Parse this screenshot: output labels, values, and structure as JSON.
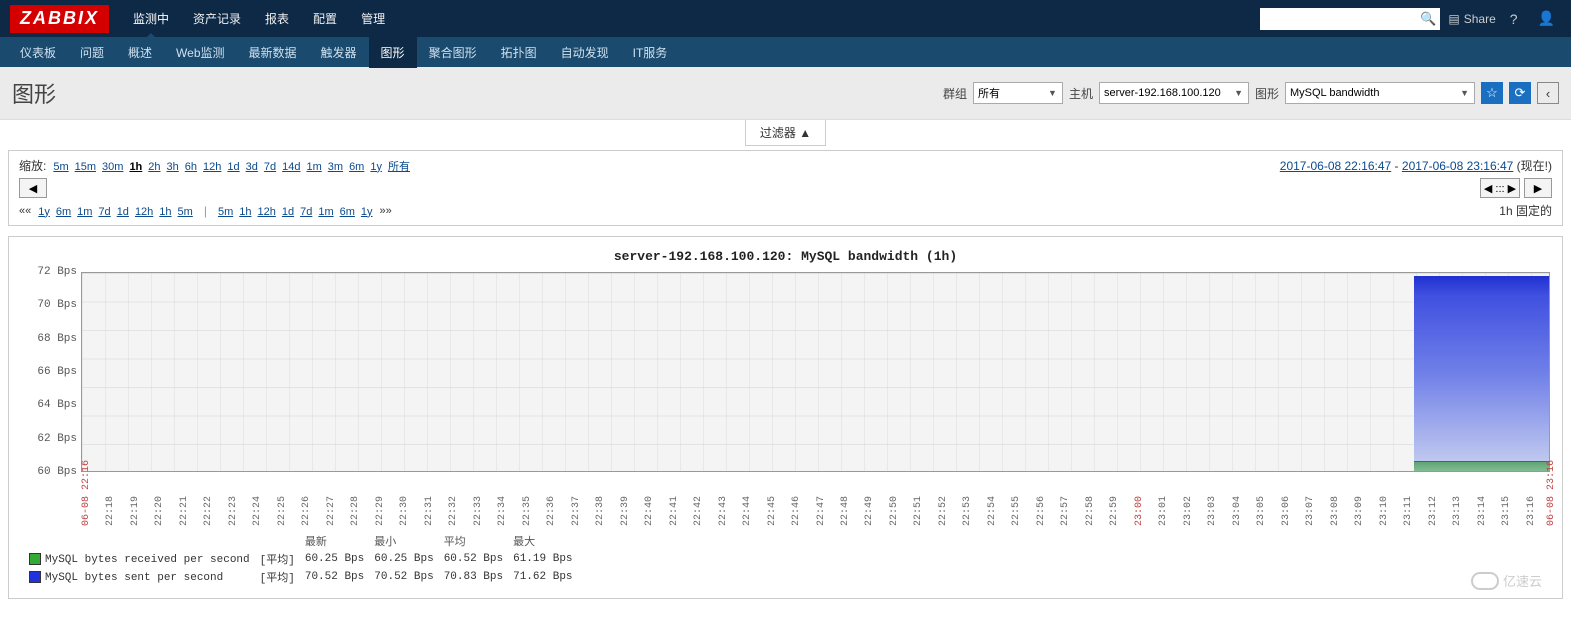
{
  "app": {
    "logo": "ZABBIX"
  },
  "topnav": [
    "监测中",
    "资产记录",
    "报表",
    "配置",
    "管理"
  ],
  "topnav_active": 0,
  "subnav": [
    "仪表板",
    "问题",
    "概述",
    "Web监测",
    "最新数据",
    "触发器",
    "图形",
    "聚合图形",
    "拓扑图",
    "自动发现",
    "IT服务"
  ],
  "subnav_active": 6,
  "top_right": {
    "share": "Share",
    "help": "?",
    "search_placeholder": ""
  },
  "page_title": "图形",
  "filters": {
    "group_label": "群组",
    "group_value": "所有",
    "host_label": "主机",
    "host_value": "server-192.168.100.120",
    "graph_label": "图形",
    "graph_value": "MySQL bandwidth"
  },
  "filter_toggle": "过滤器 ▲",
  "zoom": {
    "label": "缩放:",
    "options": [
      "5m",
      "15m",
      "30m",
      "1h",
      "2h",
      "3h",
      "6h",
      "12h",
      "1d",
      "3d",
      "7d",
      "14d",
      "1m",
      "3m",
      "6m",
      "1y",
      "所有"
    ],
    "selected": "1h",
    "range_from": "2017-06-08 22:16:47",
    "range_sep": " - ",
    "range_to": "2017-06-08 23:16:47",
    "now_text": " (现在!)"
  },
  "shift_left_pre": "««",
  "shift_left": [
    "1y",
    "6m",
    "1m",
    "7d",
    "1d",
    "12h",
    "1h",
    "5m"
  ],
  "shift_right": [
    "5m",
    "1h",
    "12h",
    "1d",
    "7d",
    "1m",
    "6m",
    "1y"
  ],
  "shift_right_post": "»»",
  "fixed_label": "固定的",
  "fixed_duration": "1h",
  "nav_buttons": {
    "prev": "◀",
    "mid": "◀ ::: ▶",
    "next": "▶"
  },
  "chart_data": {
    "type": "area",
    "title": "server-192.168.100.120: MySQL bandwidth (1h)",
    "ylabel": "Bps",
    "yticks": [
      72,
      70,
      68,
      66,
      64,
      62,
      60
    ],
    "ylim": [
      60,
      72
    ],
    "x_start": "06-08 22:16",
    "x_end": "06-08 23:16",
    "x_minutes": [
      "22:18",
      "22:19",
      "22:20",
      "22:21",
      "22:22",
      "22:23",
      "22:24",
      "22:25",
      "22:26",
      "22:27",
      "22:28",
      "22:29",
      "22:30",
      "22:31",
      "22:32",
      "22:33",
      "22:34",
      "22:35",
      "22:36",
      "22:37",
      "22:38",
      "22:39",
      "22:40",
      "22:41",
      "22:42",
      "22:43",
      "22:44",
      "22:45",
      "22:46",
      "22:47",
      "22:48",
      "22:49",
      "22:50",
      "22:51",
      "22:52",
      "22:53",
      "22:54",
      "22:55",
      "22:56",
      "22:57",
      "22:58",
      "22:59",
      "23:00",
      "23:01",
      "23:02",
      "23:03",
      "23:04",
      "23:05",
      "23:06",
      "23:07",
      "23:08",
      "23:09",
      "23:10",
      "23:11",
      "23:12",
      "23:13",
      "23:14",
      "23:15",
      "23:16"
    ],
    "x_hour_marks": [
      "23:00"
    ],
    "series": [
      {
        "name": "MySQL bytes received per second",
        "color": "#33aa33",
        "agg": "[平均]",
        "last": "60.25 Bps",
        "min": "60.25 Bps",
        "avg": "60.52 Bps",
        "max": "61.19 Bps",
        "data_segment": {
          "start": "23:10",
          "values_bps": [
            60.3,
            60.4,
            60.6,
            60.5,
            60.5,
            61.0,
            60.6,
            60.3
          ]
        }
      },
      {
        "name": "MySQL bytes sent per second",
        "color": "#2233dd",
        "agg": "[平均]",
        "last": "70.52 Bps",
        "min": "70.52 Bps",
        "avg": "70.83 Bps",
        "max": "71.62 Bps",
        "data_segment": {
          "start": "23:10",
          "values_bps": [
            70.8,
            70.7,
            70.9,
            70.8,
            70.8,
            71.5,
            71.0,
            70.6
          ]
        }
      }
    ],
    "legend_headers": [
      "最新",
      "最小",
      "平均",
      "最大"
    ]
  },
  "watermark": "亿速云"
}
